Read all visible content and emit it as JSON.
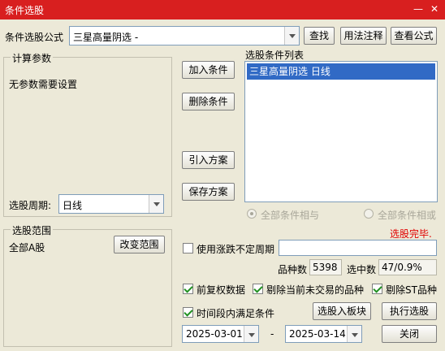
{
  "window": {
    "title": "条件选股",
    "minimize_glyph": "—",
    "close_glyph": "✕"
  },
  "formula": {
    "label": "条件选股公式",
    "value": "三星高量阴选 -",
    "find_button": "查找",
    "usage_button": "用法注释",
    "view_button": "查看公式"
  },
  "params": {
    "group_title": "计算参数",
    "message": "无参数需要设置",
    "period_label": "选股周期:",
    "period_value": "日线"
  },
  "conditions": {
    "list_title": "选股条件列表",
    "items": [
      "三星高量阴选  日线"
    ],
    "add_button": "加入条件",
    "delete_button": "删除条件",
    "import_button": "引入方案",
    "save_button": "保存方案",
    "radio_and": "全部条件相与",
    "radio_or": "全部条件相或"
  },
  "status": {
    "text": "选股完毕.",
    "color": "#e00000"
  },
  "scope": {
    "group_title": "选股范围",
    "value": "全部A股",
    "change_button": "改变范围"
  },
  "options": {
    "unfixed_period": {
      "label": "使用涨跌不定周期",
      "checked": false
    },
    "count_label": "品种数",
    "count_value": "5398",
    "selected_label": "选中数",
    "selected_value": "47/0.9%",
    "forward_adjust": {
      "label": "前复权数据",
      "checked": true
    },
    "exclude_untraded": {
      "label": "剔除当前未交易的品种",
      "checked": true
    },
    "exclude_st": {
      "label": "剔除ST品种",
      "checked": true
    },
    "period_condition": {
      "label": "时间段内满足条件",
      "checked": true
    }
  },
  "actions": {
    "add_to_block": "选股入板块",
    "execute": "执行选股",
    "close": "关闭"
  },
  "dates": {
    "start": "2025-03-01",
    "separator": "-",
    "end": "2025-03-14"
  }
}
